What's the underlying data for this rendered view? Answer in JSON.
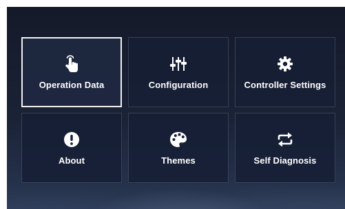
{
  "menu": {
    "tiles": [
      {
        "label": "Operation Data",
        "icon": "touch-hand-icon",
        "selected": true
      },
      {
        "label": "Configuration",
        "icon": "sliders-icon",
        "selected": false
      },
      {
        "label": "Controller Settings",
        "icon": "gear-icon",
        "selected": false
      },
      {
        "label": "About",
        "icon": "info-exclamation-icon",
        "selected": false
      },
      {
        "label": "Themes",
        "icon": "palette-icon",
        "selected": false
      },
      {
        "label": "Self Diagnosis",
        "icon": "sync-arrows-icon",
        "selected": false
      }
    ]
  },
  "colors": {
    "background_top": "#151a2a",
    "background_bottom": "#2c3a56",
    "tile_background": "#161f34",
    "selected_border": "#f2f2f2",
    "text": "#ffffff"
  }
}
